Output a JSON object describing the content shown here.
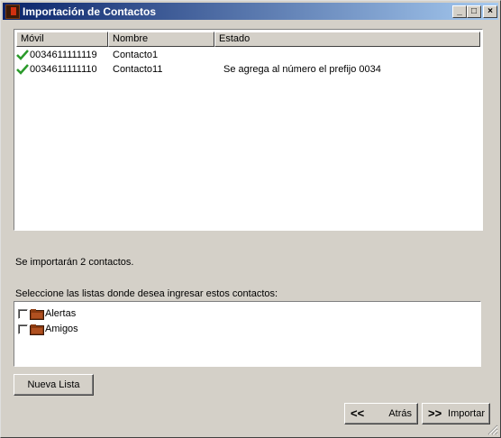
{
  "window": {
    "title": "Importación de Contactos",
    "minimize": "_",
    "maximize": "□",
    "close": "×"
  },
  "table": {
    "columns": [
      "Móvil",
      "Nombre",
      "Estado"
    ],
    "rows": [
      {
        "movil": "0034611111119",
        "nombre": "Contacto1",
        "estado": ""
      },
      {
        "movil": "0034611111110",
        "nombre": "Contacto11",
        "estado": "Se agrega al número el prefijo 0034"
      }
    ]
  },
  "summary": "Se importarán 2 contactos.",
  "lists_prompt": "Seleccione las listas donde desea ingresar estos contactos:",
  "lists": [
    {
      "label": "Alertas",
      "checked": false
    },
    {
      "label": "Amigos",
      "checked": false
    }
  ],
  "buttons": {
    "new_list": "Nueva Lista",
    "back": "Atrás",
    "back_icon": "<<",
    "import": "Importar",
    "import_icon": ">>"
  },
  "colors": {
    "title_start": "#0a246a",
    "title_end": "#a6caf0",
    "check_green": "#2a9a2a",
    "folder_brown": "#8a3a10"
  }
}
